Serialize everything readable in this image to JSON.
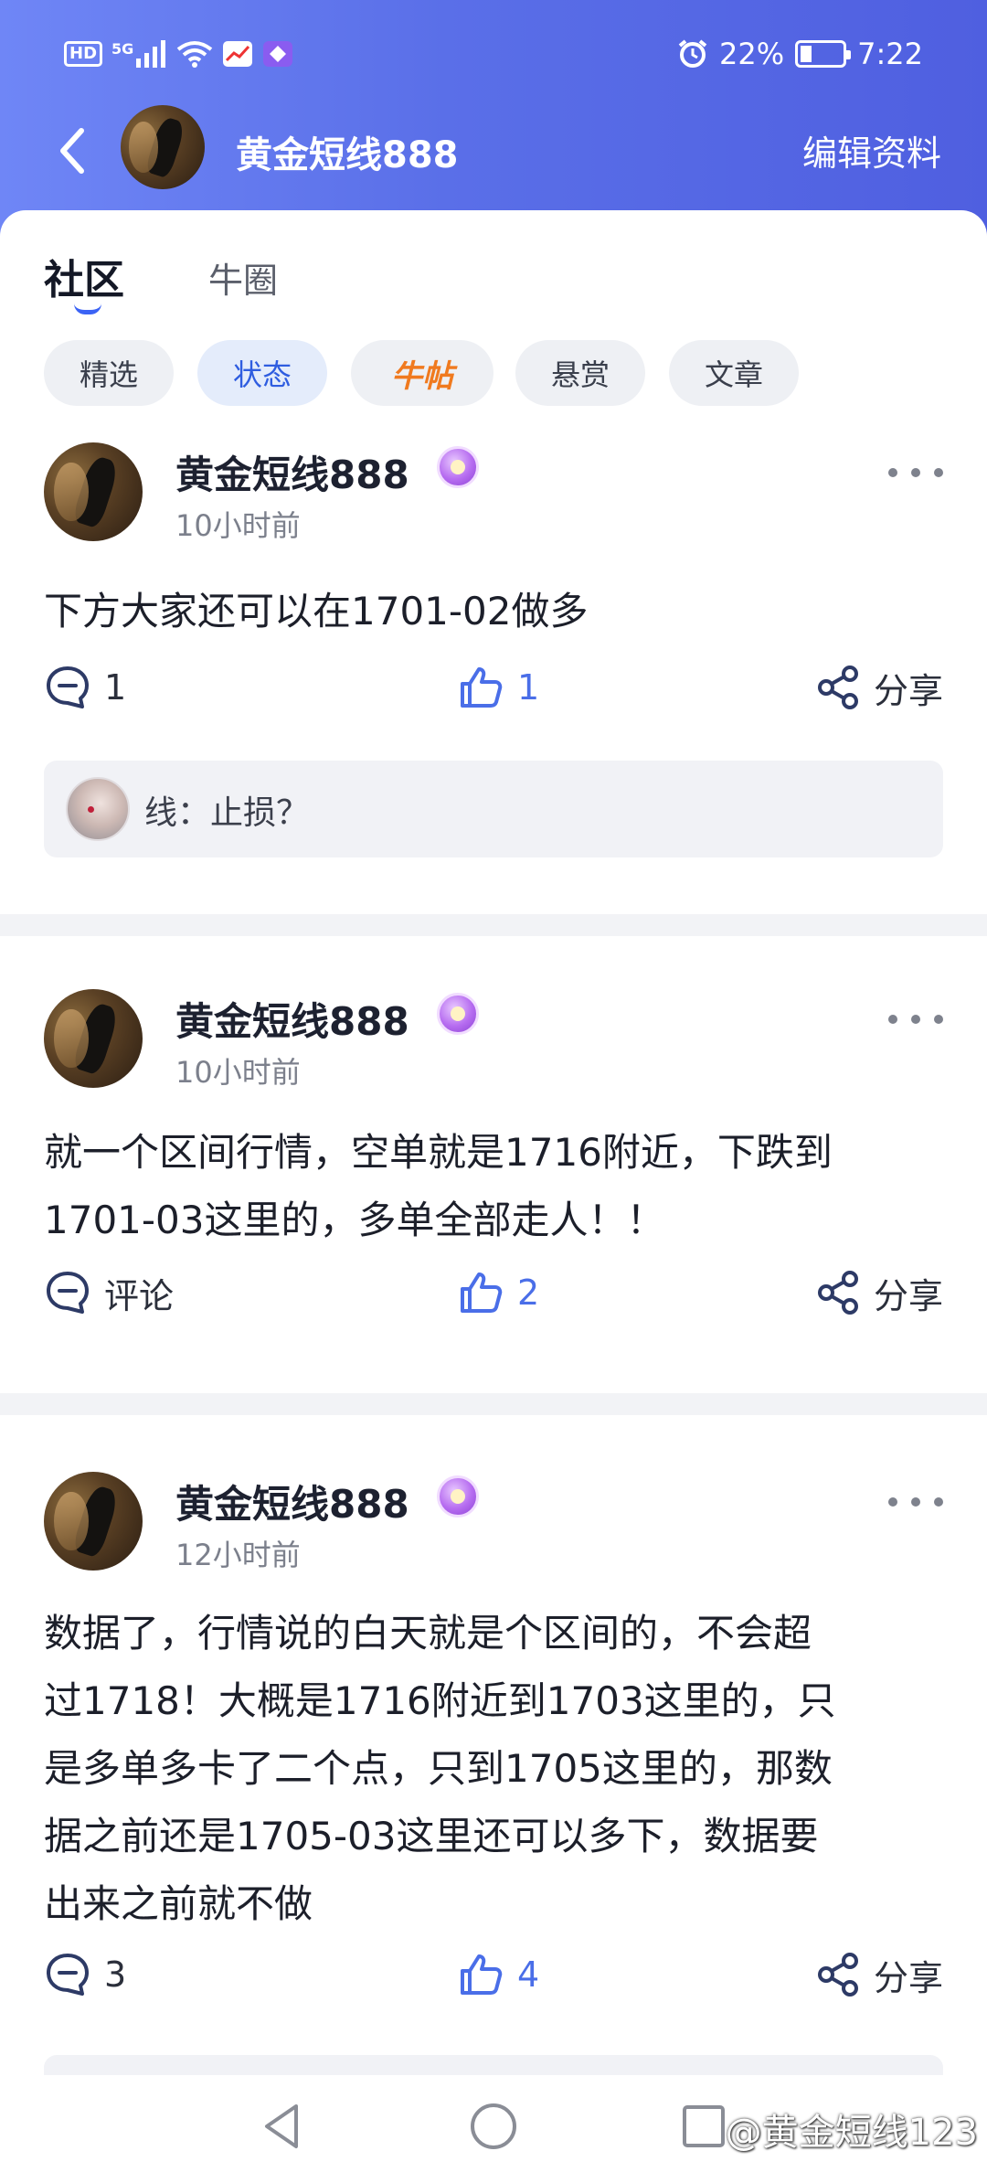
{
  "status_bar": {
    "hd_label": "HD",
    "signal_label": "5G",
    "battery_percent": "22%",
    "time": "7:22",
    "battery_level": 0.22
  },
  "header": {
    "user_name": "黄金短线888",
    "edit_label": "编辑资料"
  },
  "tabs": [
    {
      "label": "社区",
      "active": true
    },
    {
      "label": "牛圈",
      "active": false
    }
  ],
  "chips": [
    {
      "label": "精选",
      "active": false
    },
    {
      "label": "状态",
      "active": true
    },
    {
      "label": "牛帖",
      "active": false
    },
    {
      "label": "悬赏",
      "active": false
    },
    {
      "label": "文章",
      "active": false
    }
  ],
  "posts": [
    {
      "author": "黄金短线888",
      "time": "10小时前",
      "lines": [
        "下方大家还可以在1701-02做多"
      ],
      "comment_label": "1",
      "likes": "1",
      "share_label": "分享",
      "reply": {
        "text": "线：止损？"
      }
    },
    {
      "author": "黄金短线888",
      "time": "10小时前",
      "lines": [
        "就一个区间行情，空单就是1716附近，下跌到",
        "1701-03这里的，多单全部走人！！"
      ],
      "comment_label": "评论",
      "likes": "2",
      "share_label": "分享"
    },
    {
      "author": "黄金短线888",
      "time": "12小时前",
      "lines": [
        "数据了，行情说的白天就是个区间的，不会超",
        "过1718！大概是1716附近到1703这里的，只",
        "是多单多卡了二个点，只到1705这里的，那数",
        "据之前还是1705-03这里还可以多下，数据要",
        "出来之前就不做"
      ],
      "comment_label": "3",
      "likes": "4",
      "share_label": "分享"
    }
  ],
  "watermark": "@黄金短线123",
  "colors": {
    "header_start": "#6f86f6",
    "header_end": "#4f5fe0",
    "accent_blue": "#3b63f5",
    "niutie_orange": "#f07a1f"
  }
}
